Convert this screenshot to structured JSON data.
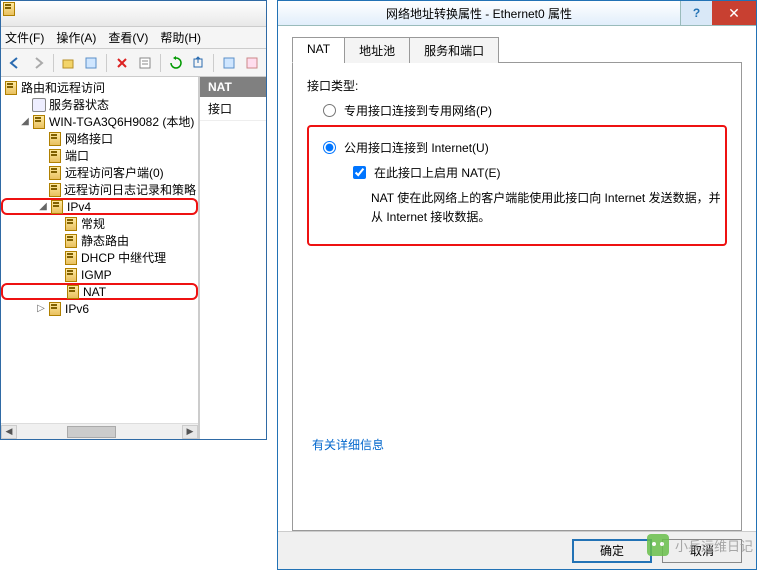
{
  "main_window": {
    "menus": {
      "file": "文件(F)",
      "action": "操作(A)",
      "view": "查看(V)",
      "help": "帮助(H)"
    },
    "tree": {
      "root": "路由和远程访问",
      "server_status": "服务器状态",
      "server_node": "WIN-TGA3Q6H9082 (本地)",
      "network_if": "网络接口",
      "ports": "端口",
      "remote_clients": "远程访问客户端(0)",
      "remote_log": "远程访问日志记录和策略",
      "ipv4": "IPv4",
      "general": "常规",
      "static_route": "静态路由",
      "dhcp_relay": "DHCP 中继代理",
      "igmp": "IGMP",
      "nat": "NAT",
      "ipv6": "IPv6"
    },
    "right": {
      "header": "NAT",
      "row1": "接口"
    }
  },
  "dialog": {
    "title": "网络地址转换属性 - Ethernet0 属性",
    "tabs": {
      "nat": "NAT",
      "pool": "地址池",
      "services": "服务和端口"
    },
    "interface_type_label": "接口类型:",
    "radio_private": "专用接口连接到专用网络(P)",
    "radio_public": "公用接口连接到 Internet(U)",
    "checkbox_enable_nat": "在此接口上启用 NAT(E)",
    "nat_desc": "NAT 使在此网络上的客户端能使用此接口向 Internet 发送数据，并从 Internet 接收数据。",
    "more_info": "有关详细信息",
    "ok": "确定",
    "cancel": "取消"
  },
  "watermark": "小兵运维日记"
}
